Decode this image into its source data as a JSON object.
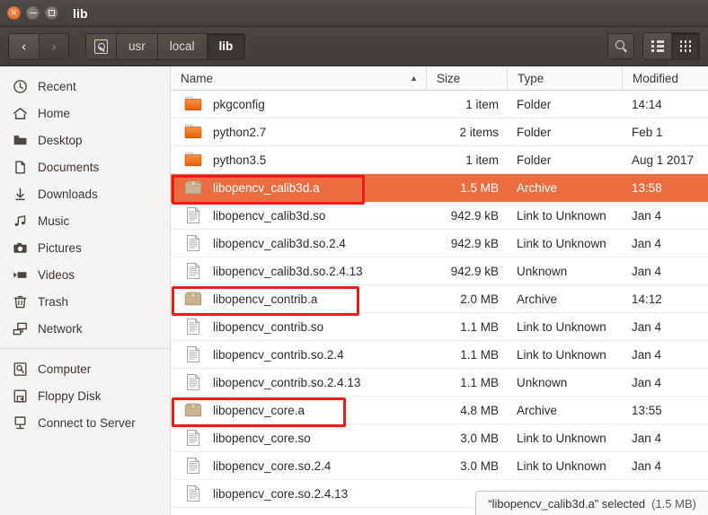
{
  "window": {
    "title": "lib",
    "controls": {
      "close": "×",
      "minimize": "–",
      "maximize": "□"
    }
  },
  "toolbar": {
    "back_label": "‹",
    "forward_label": "›",
    "breadcrumbs": [
      {
        "label": "",
        "icon": "disk-icon",
        "active": false
      },
      {
        "label": "usr",
        "active": false
      },
      {
        "label": "local",
        "active": false
      },
      {
        "label": "lib",
        "active": true
      }
    ],
    "search_icon": "search-icon",
    "list_view_icon": "list-view-icon",
    "grid_view_icon": "grid-view-icon"
  },
  "sidebar": {
    "items": [
      {
        "label": "Recent",
        "icon": "clock-icon"
      },
      {
        "label": "Home",
        "icon": "home-icon"
      },
      {
        "label": "Desktop",
        "icon": "desktop-folder-icon"
      },
      {
        "label": "Documents",
        "icon": "document-icon"
      },
      {
        "label": "Downloads",
        "icon": "download-icon"
      },
      {
        "label": "Music",
        "icon": "music-note-icon"
      },
      {
        "label": "Pictures",
        "icon": "camera-icon"
      },
      {
        "label": "Videos",
        "icon": "video-icon"
      },
      {
        "label": "Trash",
        "icon": "trash-icon"
      },
      {
        "label": "Network",
        "icon": "network-icon"
      },
      {
        "label": "Computer",
        "icon": "computer-disk-icon"
      },
      {
        "label": "Floppy Disk",
        "icon": "floppy-disk-icon"
      },
      {
        "label": "Connect to Server",
        "icon": "connect-server-icon"
      }
    ],
    "separator_after_index": 9
  },
  "file_list": {
    "columns": [
      "Name",
      "Size",
      "Type",
      "Modified"
    ],
    "sort_column": "Name",
    "sort_direction": "ascending",
    "sort_arrow": "▲",
    "rows": [
      {
        "name": "pkgconfig",
        "size": "1 item",
        "type": "Folder",
        "modified": "14:14",
        "icon": "folder-icon",
        "selected": false,
        "annotated": false
      },
      {
        "name": "python2.7",
        "size": "2 items",
        "type": "Folder",
        "modified": "Feb 1",
        "icon": "folder-icon",
        "selected": false,
        "annotated": false
      },
      {
        "name": "python3.5",
        "size": "1 item",
        "type": "Folder",
        "modified": "Aug 1 2017",
        "icon": "folder-icon",
        "selected": false,
        "annotated": false
      },
      {
        "name": "libopencv_calib3d.a",
        "size": "1.5 MB",
        "type": "Archive",
        "modified": "13:58",
        "icon": "archive-icon",
        "selected": true,
        "annotated": true
      },
      {
        "name": "libopencv_calib3d.so",
        "size": "942.9 kB",
        "type": "Link to Unknown",
        "modified": "Jan 4",
        "icon": "text-file-icon",
        "selected": false,
        "annotated": false
      },
      {
        "name": "libopencv_calib3d.so.2.4",
        "size": "942.9 kB",
        "type": "Link to Unknown",
        "modified": "Jan 4",
        "icon": "text-file-icon",
        "selected": false,
        "annotated": false
      },
      {
        "name": "libopencv_calib3d.so.2.4.13",
        "size": "942.9 kB",
        "type": "Unknown",
        "modified": "Jan 4",
        "icon": "text-file-icon",
        "selected": false,
        "annotated": false
      },
      {
        "name": "libopencv_contrib.a",
        "size": "2.0 MB",
        "type": "Archive",
        "modified": "14:12",
        "icon": "archive-icon",
        "selected": false,
        "annotated": true
      },
      {
        "name": "libopencv_contrib.so",
        "size": "1.1 MB",
        "type": "Link to Unknown",
        "modified": "Jan 4",
        "icon": "text-file-icon",
        "selected": false,
        "annotated": false
      },
      {
        "name": "libopencv_contrib.so.2.4",
        "size": "1.1 MB",
        "type": "Link to Unknown",
        "modified": "Jan 4",
        "icon": "text-file-icon",
        "selected": false,
        "annotated": false
      },
      {
        "name": "libopencv_contrib.so.2.4.13",
        "size": "1.1 MB",
        "type": "Unknown",
        "modified": "Jan 4",
        "icon": "text-file-icon",
        "selected": false,
        "annotated": false
      },
      {
        "name": "libopencv_core.a",
        "size": "4.8 MB",
        "type": "Archive",
        "modified": "13:55",
        "icon": "archive-icon",
        "selected": false,
        "annotated": true
      },
      {
        "name": "libopencv_core.so",
        "size": "3.0 MB",
        "type": "Link to Unknown",
        "modified": "Jan 4",
        "icon": "text-file-icon",
        "selected": false,
        "annotated": false
      },
      {
        "name": "libopencv_core.so.2.4",
        "size": "3.0 MB",
        "type": "Link to Unknown",
        "modified": "Jan 4",
        "icon": "text-file-icon",
        "selected": false,
        "annotated": false
      },
      {
        "name": "libopencv_core.so.2.4.13",
        "size": "",
        "type": "",
        "modified": "",
        "icon": "text-file-icon",
        "selected": false,
        "annotated": false
      }
    ]
  },
  "status_bar": {
    "text": "“libopencv_calib3d.a” selected",
    "size": "(1.5 MB)"
  },
  "colors": {
    "selection": "#ea6e3f",
    "annotation": "#ee1b1b",
    "titlebar": "#473",
    "folder": "#e8681f",
    "archive": "#c7b294"
  }
}
